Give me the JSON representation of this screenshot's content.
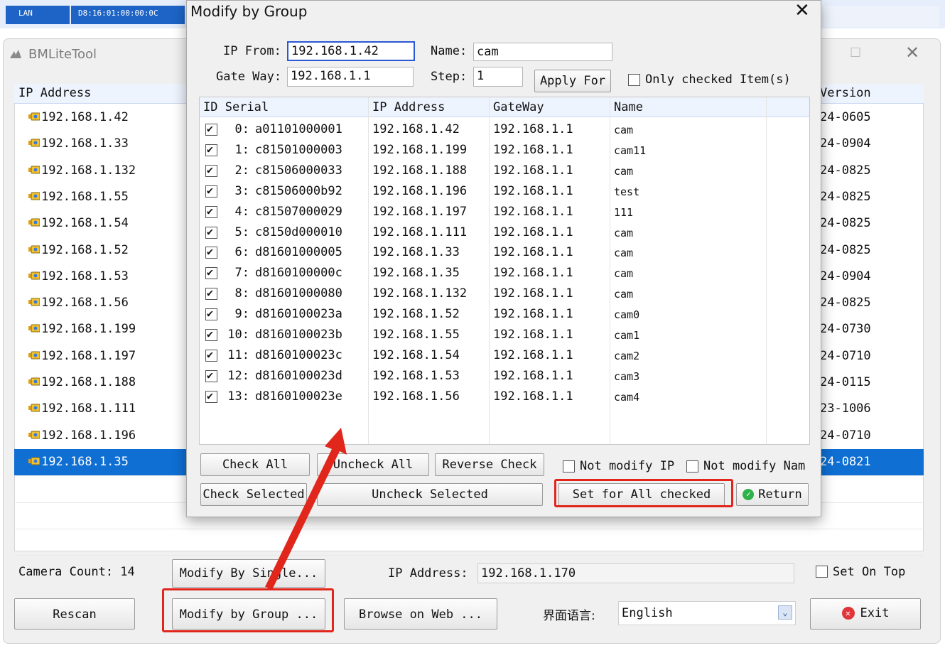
{
  "topbar": {
    "lan": "LAN",
    "mac": "D8:16:01:00:00:0C"
  },
  "app": {
    "title": "BMLiteTool"
  },
  "list": {
    "col_ip": "IP Address",
    "col_version": "Version",
    "rows": [
      {
        "ip": "192.168.1.42",
        "version": "24-0605"
      },
      {
        "ip": "192.168.1.33",
        "version": "24-0904"
      },
      {
        "ip": "192.168.1.132",
        "version": "24-0825"
      },
      {
        "ip": "192.168.1.55",
        "version": "24-0825"
      },
      {
        "ip": "192.168.1.54",
        "version": "24-0825"
      },
      {
        "ip": "192.168.1.52",
        "version": "24-0825"
      },
      {
        "ip": "192.168.1.53",
        "version": "24-0904"
      },
      {
        "ip": "192.168.1.56",
        "version": "24-0825"
      },
      {
        "ip": "192.168.1.199",
        "version": "24-0730"
      },
      {
        "ip": "192.168.1.197",
        "version": "24-0710"
      },
      {
        "ip": "192.168.1.188",
        "version": "24-0115"
      },
      {
        "ip": "192.168.1.111",
        "version": "23-1006"
      },
      {
        "ip": "192.168.1.196",
        "version": "24-0710"
      },
      {
        "ip": "192.168.1.35",
        "version": "24-0821"
      }
    ]
  },
  "bottom": {
    "camera_count_label": "Camera Count: 14",
    "modify_single": "Modify By Single...",
    "ip_label": "IP Address:",
    "ip_value": "192.168.1.170",
    "set_on_top": "Set On Top",
    "rescan": "Rescan",
    "modify_group": "Modify by Group ...",
    "browse_web": "Browse on Web ...",
    "lang_label": "界面语言:",
    "lang_value": "English",
    "exit": "Exit"
  },
  "dialog": {
    "title": "Modify by Group",
    "ip_from_label": "IP From:",
    "ip_from_value": "192.168.1.42",
    "name_label": "Name:",
    "name_value": "cam",
    "gateway_label": "Gate Way:",
    "gateway_value": "192.168.1.1",
    "step_label": "Step:",
    "step_value": "1",
    "apply_for": "Apply For",
    "only_checked": "Only checked Item(s)",
    "columns": [
      "ID Serial",
      "IP Address",
      "GateWay",
      "Name"
    ],
    "rows": [
      {
        "id": "0:",
        "serial": "a01101000001",
        "ip": "192.168.1.42",
        "gw": "192.168.1.1",
        "name": "cam"
      },
      {
        "id": "1:",
        "serial": "c81501000003",
        "ip": "192.168.1.199",
        "gw": "192.168.1.1",
        "name": "cam11"
      },
      {
        "id": "2:",
        "serial": "c81506000033",
        "ip": "192.168.1.188",
        "gw": "192.168.1.1",
        "name": "cam"
      },
      {
        "id": "3:",
        "serial": "c81506000b92",
        "ip": "192.168.1.196",
        "gw": "192.168.1.1",
        "name": "test"
      },
      {
        "id": "4:",
        "serial": "c81507000029",
        "ip": "192.168.1.197",
        "gw": "192.168.1.1",
        "name": "111"
      },
      {
        "id": "5:",
        "serial": "c8150d000010",
        "ip": "192.168.1.111",
        "gw": "192.168.1.1",
        "name": "cam"
      },
      {
        "id": "6:",
        "serial": "d81601000005",
        "ip": "192.168.1.33",
        "gw": "192.168.1.1",
        "name": "cam"
      },
      {
        "id": "7:",
        "serial": "d8160100000c",
        "ip": "192.168.1.35",
        "gw": "192.168.1.1",
        "name": "cam"
      },
      {
        "id": "8:",
        "serial": "d81601000080",
        "ip": "192.168.1.132",
        "gw": "192.168.1.1",
        "name": "cam"
      },
      {
        "id": "9:",
        "serial": "d8160100023a",
        "ip": "192.168.1.52",
        "gw": "192.168.1.1",
        "name": "cam0"
      },
      {
        "id": "10:",
        "serial": "d8160100023b",
        "ip": "192.168.1.55",
        "gw": "192.168.1.1",
        "name": "cam1"
      },
      {
        "id": "11:",
        "serial": "d8160100023c",
        "ip": "192.168.1.54",
        "gw": "192.168.1.1",
        "name": "cam2"
      },
      {
        "id": "12:",
        "serial": "d8160100023d",
        "ip": "192.168.1.53",
        "gw": "192.168.1.1",
        "name": "cam3"
      },
      {
        "id": "13:",
        "serial": "d8160100023e",
        "ip": "192.168.1.56",
        "gw": "192.168.1.1",
        "name": "cam4"
      }
    ],
    "check_all": "Check All",
    "uncheck_all": "Uncheck All",
    "reverse_check": "Reverse Check",
    "not_modify_ip": "Not modify IP",
    "not_modify_name": "Not modify Nam",
    "check_selected": "Check Selected",
    "uncheck_selected": "Uncheck Selected",
    "set_all_checked": "Set for All checked",
    "return": "Return"
  },
  "colors": {
    "selection": "#0f6fd3",
    "highlight": "#e1261c",
    "accent": "#2a58d6"
  }
}
